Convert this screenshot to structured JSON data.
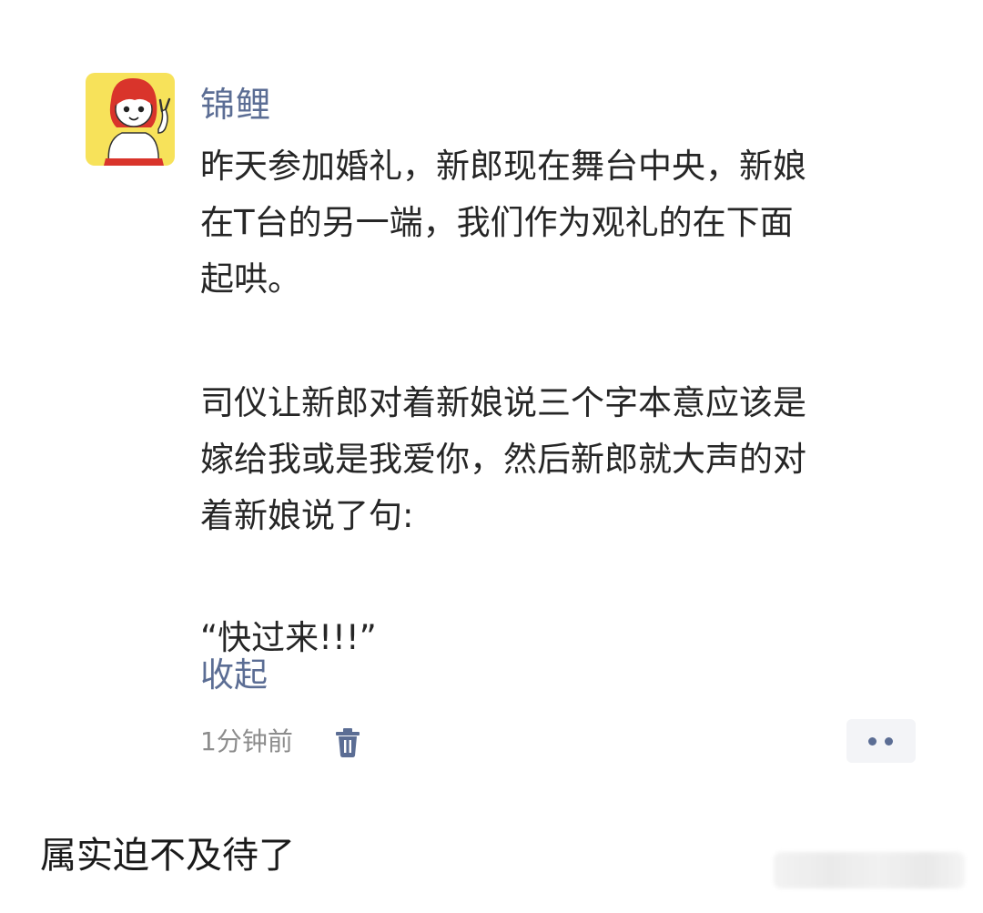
{
  "post": {
    "username": "锦鲤",
    "paragraphs": [
      [
        "昨天参加婚礼，新郎现在舞台中央，新娘",
        "在T台的另一端，我们作为观礼的在下面",
        "起哄。"
      ],
      [
        "司仪让新郎对着新娘说三个字本意应该是",
        "嫁给我或是我爱你，然后新郎就大声的对",
        "着新娘说了句:"
      ],
      [
        "“快过来!!!”"
      ]
    ],
    "collapse_label": "收起",
    "timestamp": "1分钟前",
    "icons": {
      "avatar": "avatar-cartoon-girl",
      "delete": "trash-icon",
      "more": "more-dots-icon"
    }
  },
  "caption": "属实迫不及待了",
  "colors": {
    "link": "#5b6d94",
    "text": "#262626",
    "meta": "#8c8c8c",
    "avatar_bg": "#f7e25a"
  }
}
